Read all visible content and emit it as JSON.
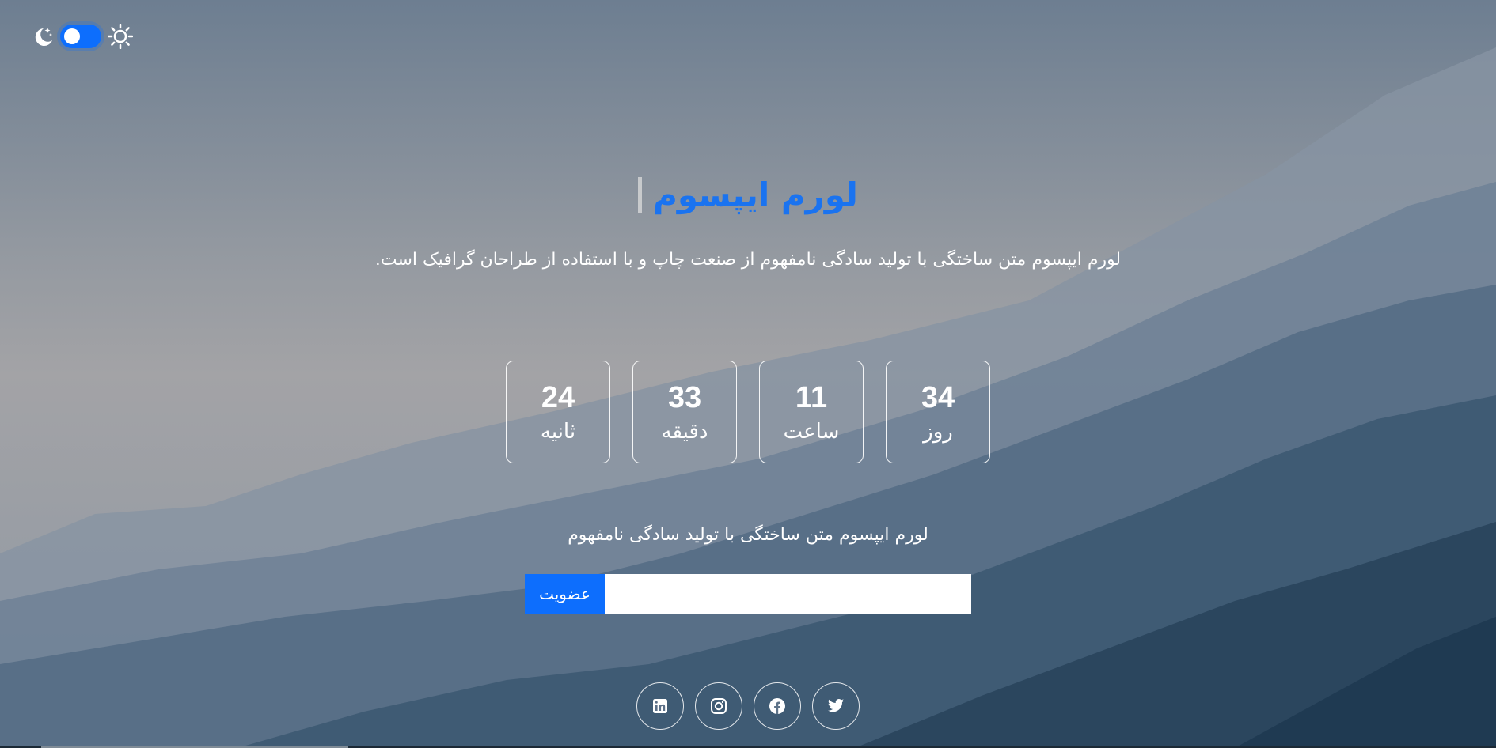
{
  "theme_toggle": {
    "dark_icon": "moon-stars-icon",
    "light_icon": "sun-icon",
    "state": "on"
  },
  "hero": {
    "title": "لورم ایپسوم",
    "subtitle": "لورم ایپسوم متن ساختگی با تولید سادگی نامفهوم از صنعت چاپ و با استفاده از طراحان گرافیک است."
  },
  "countdown": [
    {
      "value": "34",
      "label": "روز"
    },
    {
      "value": "11",
      "label": "ساعت"
    },
    {
      "value": "33",
      "label": "دقیقه"
    },
    {
      "value": "24",
      "label": "ثانیه"
    }
  ],
  "newsletter": {
    "note": "لورم ایپسوم متن ساختگی با تولید سادگی نامفهوم",
    "input_value": "",
    "button_label": "عضویت"
  },
  "social": [
    {
      "icon": "twitter-icon"
    },
    {
      "icon": "facebook-icon"
    },
    {
      "icon": "instagram-icon"
    },
    {
      "icon": "linkedin-icon"
    }
  ],
  "colors": {
    "accent": "#0d6efd",
    "title": "#1a73f0"
  }
}
